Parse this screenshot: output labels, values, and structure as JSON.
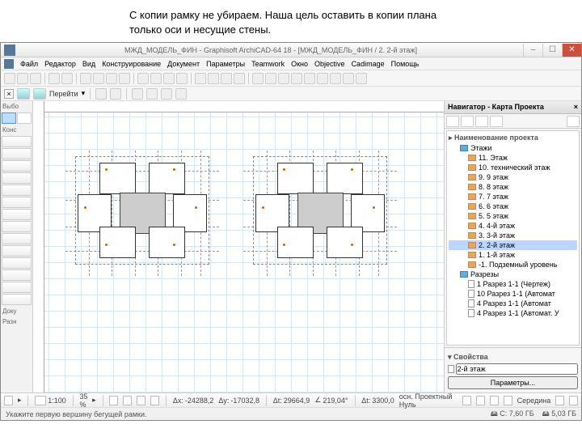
{
  "caption": {
    "line1": "С копии рамку не убираем. Наша цель оставить в копии плана",
    "line2": " только оси и несущие стены."
  },
  "titlebar": {
    "title": "МЖД_МОДЕЛЬ_ФИН - Graphisoft ArchiCAD-64 18 - [МЖД_МОДЕЛЬ_ФИН / 2. 2-й этаж]"
  },
  "menus": [
    "Файл",
    "Редактор",
    "Вид",
    "Конструирование",
    "Документ",
    "Параметры",
    "Teamwork",
    "Окно",
    "Objective",
    "Cadimage",
    "Помощь"
  ],
  "nav": {
    "go_label": "Перейти"
  },
  "toolbox": {
    "select_label": "Выбо",
    "construct_label": "Конс",
    "doc_label": "Доку",
    "more_label": "Разн"
  },
  "navigator": {
    "title": "Навигатор - Карта Проекта",
    "project_label": "Наименование проекта",
    "stories_label": "Этажи",
    "stories": [
      "11. Этаж",
      "10. технический этаж",
      "9. 9 этаж",
      "8. 8 этаж",
      "7. 7 этаж",
      "6. 6 этаж",
      "5. 5 этаж",
      "4. 4-й этаж",
      "3. 3-й этаж",
      "2. 2-й этаж",
      "1. 1-й этаж",
      "-1. Подземный уровень"
    ],
    "selected_story_index": 9,
    "sections_label": "Разрезы",
    "sections": [
      "1 Разрез 1-1 (Чертеж)",
      "10 Разрез 1-1 (Автомат",
      "4 Разрез 1-1 (Автомат",
      "4 Разрез 1-1 (Автомат. У"
    ],
    "props_label": "Свойства",
    "props_value": "2-й этаж",
    "params_btn": "Параметры..."
  },
  "status": {
    "scale": "1:100",
    "zoom": "35 %",
    "angle": "219,04°",
    "dx_label": "Δx:",
    "dx": "-24288,2",
    "dy_label": "Δy:",
    "dy": "-17032,8",
    "ax_label": "Δt:",
    "ax": "29664,9",
    "dd_label": "Δt:",
    "dd": "3300,0",
    "origin": "осн. Проектный Нуль",
    "middle_label": "Середина"
  },
  "hint": "Укажите первую вершину бегущей рамки.",
  "disk": {
    "c": "C: 7,60 ГБ",
    "d": "5,03 ГБ"
  }
}
